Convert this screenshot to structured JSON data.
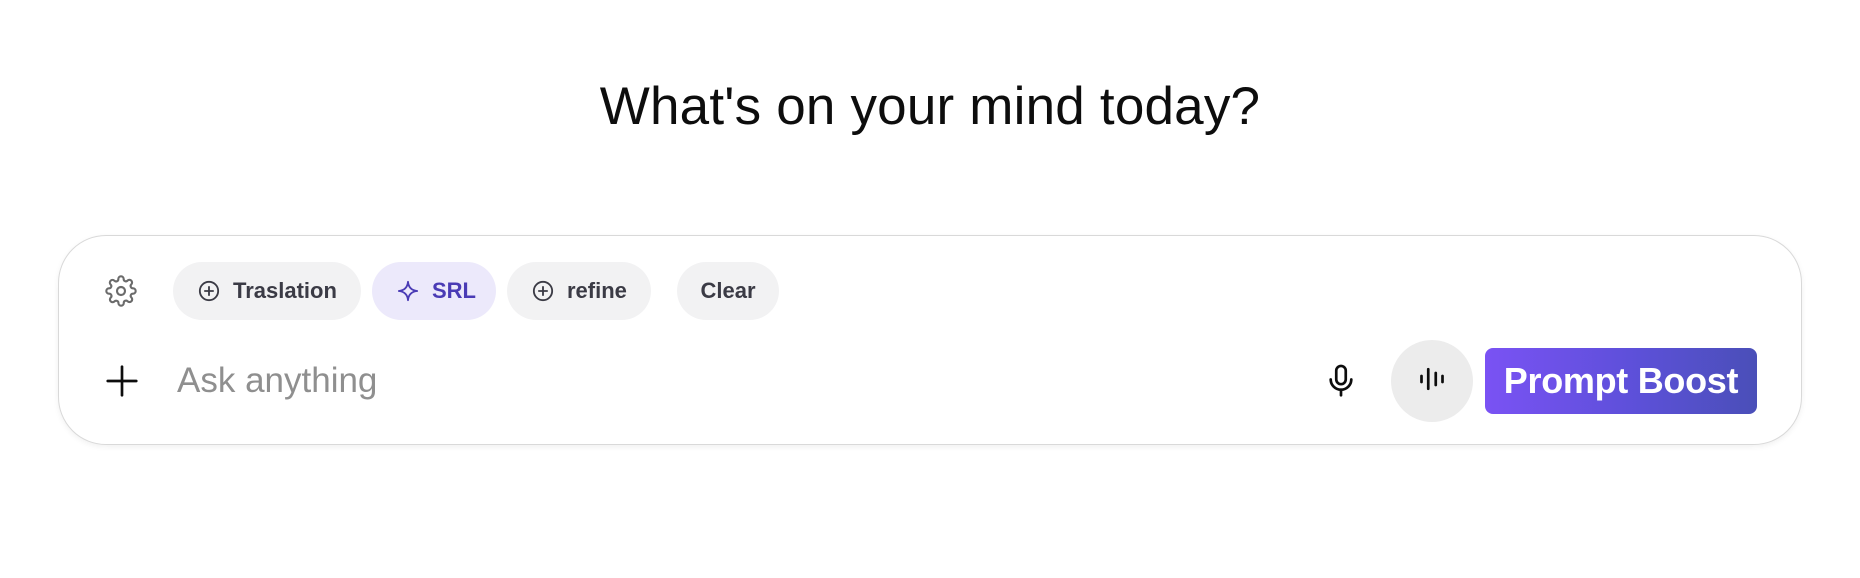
{
  "headline": "What's on your mind today?",
  "toolbar": {
    "settings_icon": "gear-icon",
    "chips": [
      {
        "label": "Traslation",
        "icon": "plus-circle-icon"
      },
      {
        "label": "SRL",
        "icon": "sparkle-icon"
      },
      {
        "label": "refine",
        "icon": "plus-circle-icon"
      },
      {
        "label": "Clear"
      }
    ]
  },
  "input": {
    "placeholder": "Ask anything",
    "value": ""
  },
  "actions": {
    "attach_icon": "plus-icon",
    "mic_icon": "microphone-icon",
    "voice_icon": "voice-waveform-icon",
    "boost_label": "Prompt Boost"
  },
  "colors": {
    "accent_start": "#7a52f4",
    "accent_end": "#4a4fb8",
    "srl_chip_bg": "#ece9fb",
    "srl_chip_text": "#4a3bb5",
    "chip_bg": "#f2f2f3"
  }
}
